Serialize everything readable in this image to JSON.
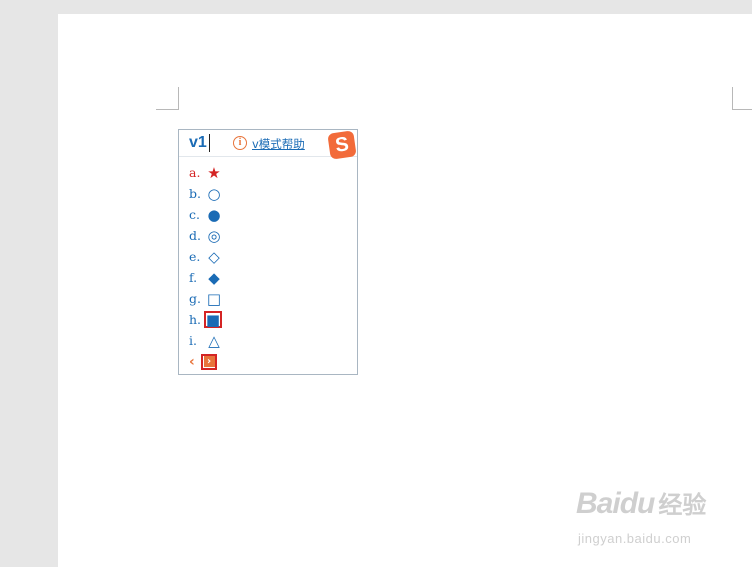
{
  "ime": {
    "input_text": "v1",
    "help_link": "v模式帮助",
    "help_icon": "info-icon",
    "logo": "S",
    "candidates": [
      {
        "label": "a.",
        "symbol": "★"
      },
      {
        "label": "b.",
        "symbol": "○"
      },
      {
        "label": "c.",
        "symbol": "●"
      },
      {
        "label": "d.",
        "symbol": "◎"
      },
      {
        "label": "e.",
        "symbol": "◇"
      },
      {
        "label": "f.",
        "symbol": "◆"
      },
      {
        "label": "g.",
        "symbol": "□"
      },
      {
        "label": "h.",
        "symbol": "■"
      },
      {
        "label": "i.",
        "symbol": "△"
      }
    ],
    "pager": {
      "prev": "‹",
      "next": "›"
    }
  },
  "watermark": {
    "brand": "Bai",
    "brand2": "du",
    "cn": "经验",
    "url": "jingyan.baidu.com"
  },
  "colors": {
    "accent_blue": "#1a6bb5",
    "highlight_red": "#d42424",
    "sogou_orange": "#f26b3a"
  }
}
